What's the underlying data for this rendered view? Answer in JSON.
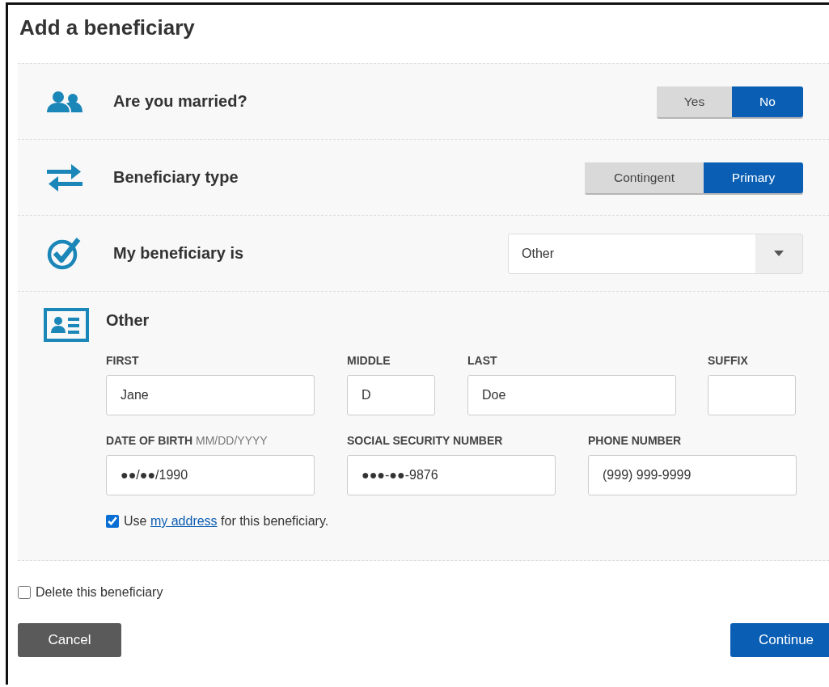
{
  "title": "Add a beneficiary",
  "questions": [
    {
      "kind": "toggle",
      "label": "Are you married?",
      "options": [
        {
          "label": "Yes",
          "selected": false
        },
        {
          "label": "No",
          "selected": true
        }
      ]
    },
    {
      "kind": "toggle",
      "label": "Beneficiary type",
      "options": [
        {
          "label": "Contingent",
          "selected": false
        },
        {
          "label": "Primary",
          "selected": true
        }
      ]
    },
    {
      "kind": "dropdown",
      "label": "My beneficiary is",
      "value": "Other"
    }
  ],
  "details": {
    "heading": "Other",
    "name_fields": [
      {
        "label": "FIRST",
        "value": "Jane"
      },
      {
        "label": "MIDDLE",
        "value": "D"
      },
      {
        "label": "LAST",
        "value": "Doe"
      },
      {
        "label": "SUFFIX"
      }
    ],
    "contact_fields": [
      {
        "label": "DATE OF BIRTH",
        "hint": "MM/DD/YYYY",
        "value": "●●/●●/1990"
      },
      {
        "label": "SOCIAL SECURITY NUMBER",
        "value": "●●●-●●-9876"
      },
      {
        "label": "PHONE NUMBER",
        "value": "(999) 999-9999"
      }
    ],
    "address_option": {
      "checked": true,
      "before": "Use",
      "link": "my address",
      "after": "for this beneficiary."
    }
  },
  "delete_option": {
    "label": "Delete this beneficiary",
    "checked": false
  },
  "buttons": [
    {
      "label": "Cancel",
      "kind": "secondary"
    },
    {
      "label": "Continue",
      "kind": "primary"
    }
  ]
}
